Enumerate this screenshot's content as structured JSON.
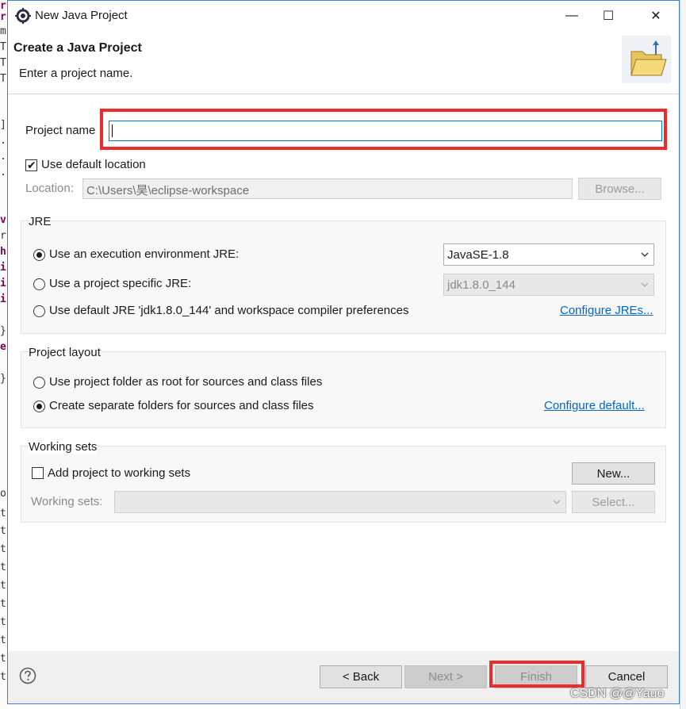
{
  "window": {
    "title": "New Java Project",
    "minimize_glyph": "—",
    "maximize_glyph": "☐",
    "close_glyph": "✕"
  },
  "header": {
    "title": "Create a Java Project",
    "subtitle": "Enter a project name.",
    "icon": "folder-icon"
  },
  "project_name": {
    "label": "Project name",
    "value": ""
  },
  "location": {
    "use_default_label": "Use default location",
    "use_default_checked": true,
    "label": "Location:",
    "value": "C:\\Users\\昊\\eclipse-workspace",
    "browse_label": "Browse..."
  },
  "jre": {
    "title": "JRE",
    "options": [
      {
        "label": "Use an execution environment JRE:",
        "selected": true
      },
      {
        "label": "Use a project specific JRE:",
        "selected": false
      },
      {
        "label": "Use default JRE 'jdk1.8.0_144' and workspace compiler preferences",
        "selected": false
      }
    ],
    "environment_value": "JavaSE-1.8",
    "project_jre_value": "jdk1.8.0_144",
    "configure_link": "Configure JREs..."
  },
  "project_layout": {
    "title": "Project layout",
    "options": [
      {
        "label": "Use project folder as root for sources and class files",
        "selected": false
      },
      {
        "label": "Create separate folders for sources and class files",
        "selected": true
      }
    ],
    "configure_link": "Configure default..."
  },
  "working_sets": {
    "title": "Working sets",
    "add_label": "Add project to working sets",
    "add_checked": false,
    "new_label": "New...",
    "sets_label": "Working sets:",
    "sets_value": "",
    "select_label": "Select..."
  },
  "footer": {
    "help_icon": "help-icon",
    "back_label": "< Back",
    "next_label": "Next >",
    "finish_label": "Finish",
    "cancel_label": "Cancel"
  },
  "watermark": "CSDN @@Yauo",
  "colors": {
    "highlight": "#ee2b2b",
    "link": "#0066cc",
    "focus_border": "#0078d7",
    "window_border": "#3b7fd6"
  }
}
